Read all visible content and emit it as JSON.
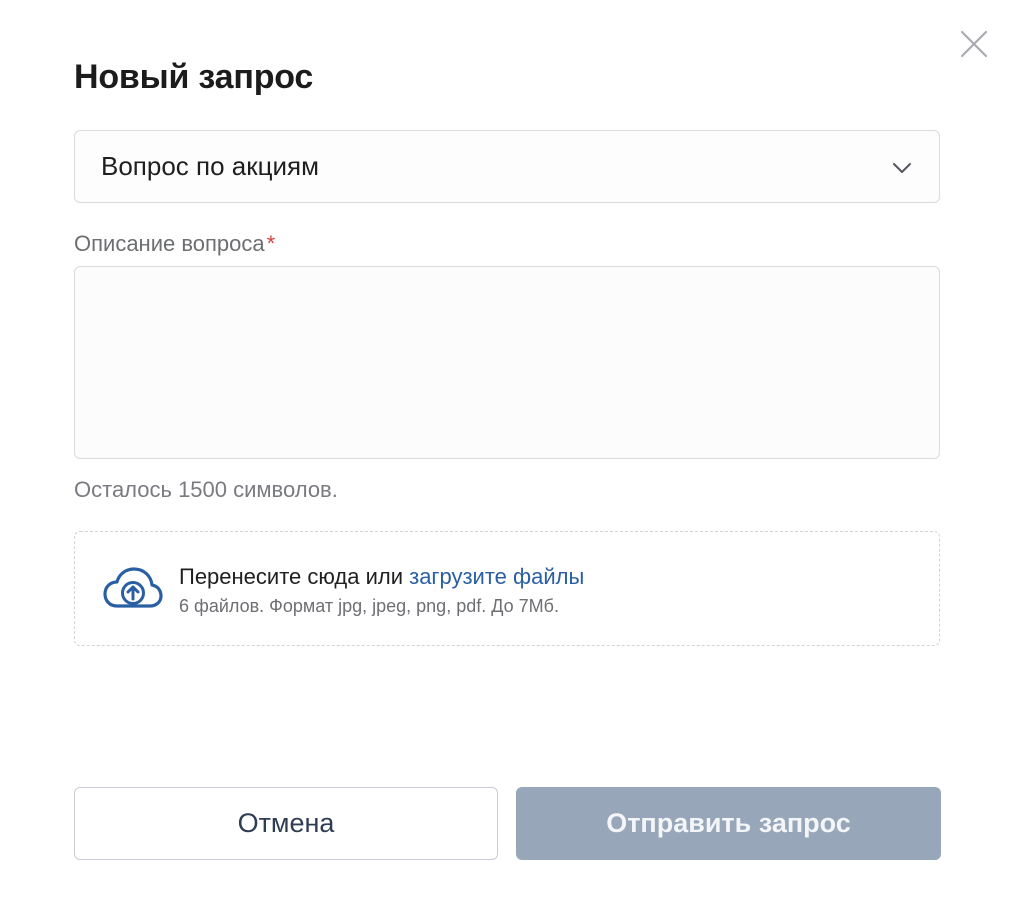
{
  "dialog": {
    "title": "Новый запрос",
    "close_icon": "close-icon"
  },
  "topic_select": {
    "selected_value": "Вопрос по акциям",
    "icon": "chevron-down-icon"
  },
  "description": {
    "label": "Описание вопроса",
    "required_mark": "*",
    "value": "",
    "counter_text": "Осталось 1500 символов."
  },
  "upload": {
    "icon": "cloud-upload-icon",
    "text_prefix": "Перенесите сюда или ",
    "link_text": "загрузите файлы",
    "hint": "6 файлов. Формат jpg, jpeg, png, pdf. До 7Мб."
  },
  "actions": {
    "cancel_label": "Отмена",
    "submit_label": "Отправить запрос",
    "submit_enabled": false
  },
  "colors": {
    "link": "#2a5fa4",
    "required": "#d0433b",
    "submit_disabled_bg": "#97a6b9",
    "cancel_text": "#2e3d52",
    "upload_icon": "#2a5fa4"
  }
}
